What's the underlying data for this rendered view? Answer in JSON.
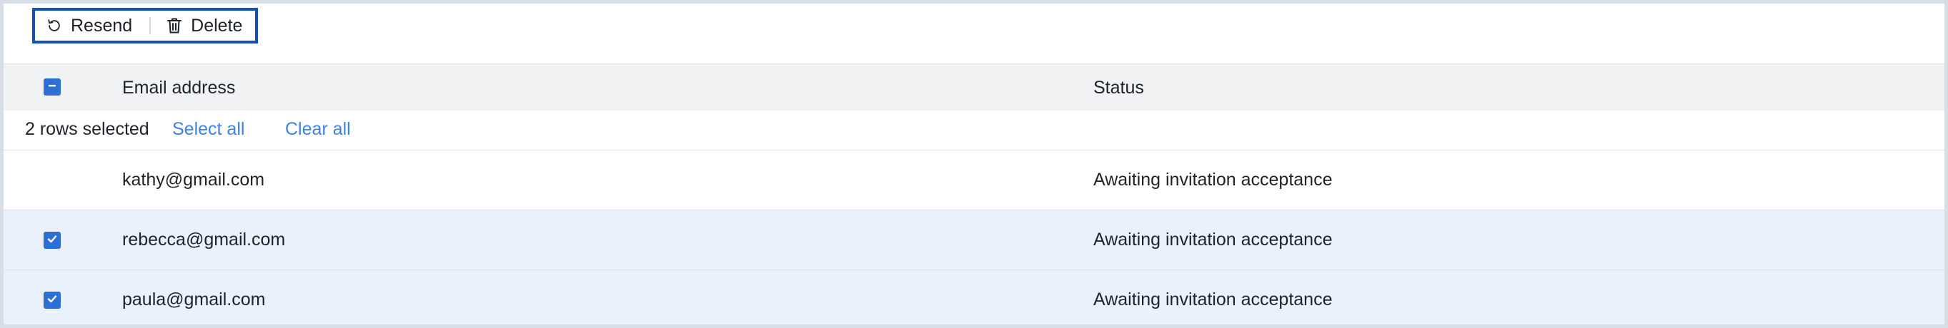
{
  "toolbar": {
    "resend_label": "Resend",
    "delete_label": "Delete",
    "resend_icon": "refresh-icon",
    "delete_icon": "trash-icon"
  },
  "table": {
    "columns": [
      "Email address",
      "Status"
    ],
    "selection": {
      "count_text": "2 rows selected",
      "select_all_label": "Select all",
      "clear_all_label": "Clear all"
    },
    "rows": [
      {
        "email": "kathy@gmail.com",
        "status": "Awaiting invitation acceptance",
        "selected": false
      },
      {
        "email": "rebecca@gmail.com",
        "status": "Awaiting invitation acceptance",
        "selected": true
      },
      {
        "email": "paula@gmail.com",
        "status": "Awaiting invitation acceptance",
        "selected": true
      }
    ]
  },
  "colors": {
    "accent": "#2d6fd6",
    "link": "#3f82e0",
    "selected_row_bg": "#e9f1fd",
    "toolbar_focus_border": "#1452b8"
  }
}
